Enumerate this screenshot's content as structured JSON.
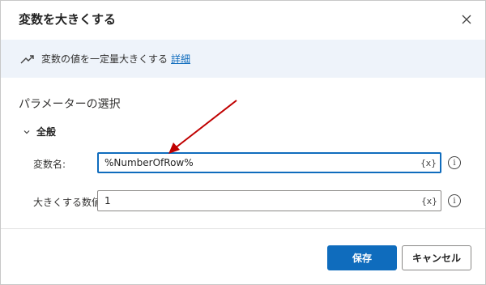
{
  "dialog": {
    "title": "変数を大きくする",
    "info": {
      "icon": "trend-up-icon",
      "description": "変数の値を一定量大きくする",
      "link": "詳細"
    },
    "section_title": "パラメーターの選択",
    "group": {
      "label": "全般",
      "expanded": true
    },
    "fields": [
      {
        "label": "変数名:",
        "value": "%NumberOfRow%",
        "var_button": "{x}"
      },
      {
        "label": "大きくする数値:",
        "value": "1",
        "var_button": "{x}"
      }
    ],
    "buttons": {
      "save": "保存",
      "cancel": "キャンセル"
    }
  },
  "colors": {
    "accent": "#0f6cbd",
    "info_bar": "#eef3fa",
    "annotation_arrow": "#c00000"
  }
}
